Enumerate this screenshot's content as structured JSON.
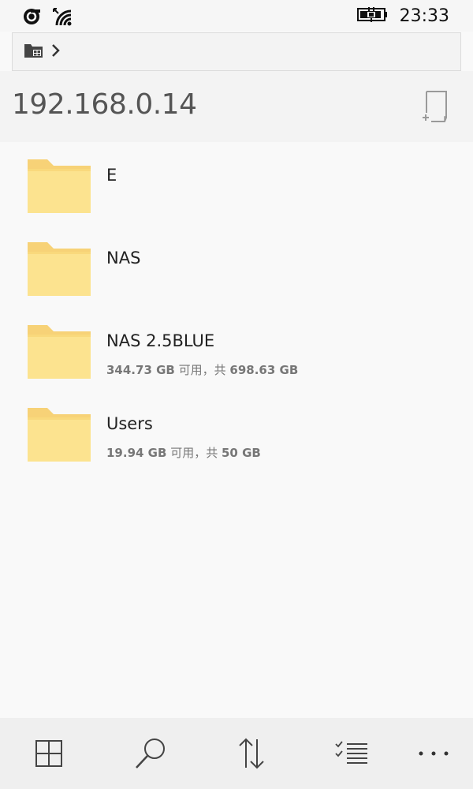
{
  "status_bar": {
    "time": "23:33",
    "icons": [
      "nfc-icon",
      "wifi-icon",
      "battery-charging-icon"
    ]
  },
  "breadcrumb": {
    "icons": [
      "network-folder-icon",
      "chevron-right-icon"
    ]
  },
  "header": {
    "title": "192.168.0.14",
    "action_icon": "add-location-icon"
  },
  "folders": [
    {
      "name": "E",
      "free": "",
      "free_label": "",
      "sep": "",
      "total": ""
    },
    {
      "name": "NAS",
      "free": "",
      "free_label": "",
      "sep": "",
      "total": ""
    },
    {
      "name": "NAS 2.5BLUE",
      "free": "344.73 GB",
      "free_label": " 可用，共 ",
      "sep": "",
      "total": "698.63 GB"
    },
    {
      "name": "Users",
      "free": "19.94 GB",
      "free_label": " 可用，共 ",
      "sep": "",
      "total": "50 GB"
    }
  ],
  "app_bar": {
    "buttons": [
      "grid-view-icon",
      "search-icon",
      "sort-icon",
      "select-icon",
      "more-icon"
    ]
  },
  "colors": {
    "folder": "#fce08a",
    "folder_tab": "#f7d277",
    "background": "#f9f9f9"
  }
}
